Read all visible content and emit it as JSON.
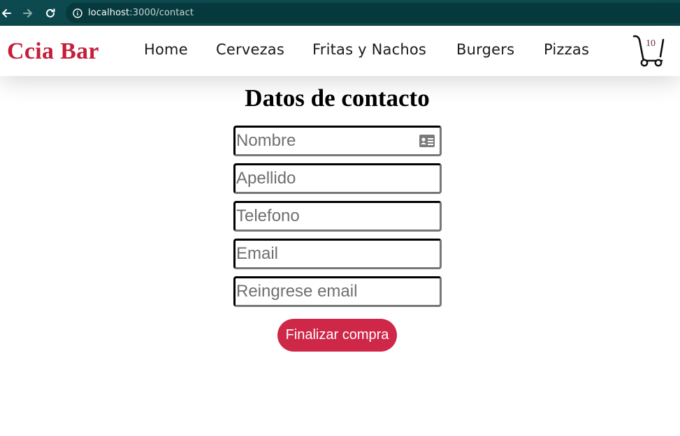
{
  "browser": {
    "back_icon": "arrow-left-icon",
    "forward_icon": "arrow-right-icon",
    "reload_icon": "reload-icon",
    "info_icon": "info-circle-icon",
    "url_host": "localhost",
    "url_path": ":3000/contact"
  },
  "header": {
    "brand": "Ccia Bar",
    "nav": [
      {
        "label": "Home"
      },
      {
        "label": "Cervezas"
      },
      {
        "label": "Fritas y Nachos"
      },
      {
        "label": "Burgers"
      },
      {
        "label": "Pizzas"
      }
    ],
    "cart": {
      "icon": "cart-icon",
      "count": "10"
    }
  },
  "form": {
    "title": "Datos de contacto",
    "fields": [
      {
        "placeholder": "Nombre",
        "value": ""
      },
      {
        "placeholder": "Apellido",
        "value": ""
      },
      {
        "placeholder": "Telefono",
        "value": ""
      },
      {
        "placeholder": "Email",
        "value": ""
      },
      {
        "placeholder": "Reingrese email",
        "value": ""
      }
    ],
    "name_field_icon": "contact-card-icon",
    "submit_label": "Finalizar compra"
  },
  "colors": {
    "browser_bar": "#0d4a4f",
    "brand": "#c41e3a",
    "submit_button": "#cf2747"
  }
}
